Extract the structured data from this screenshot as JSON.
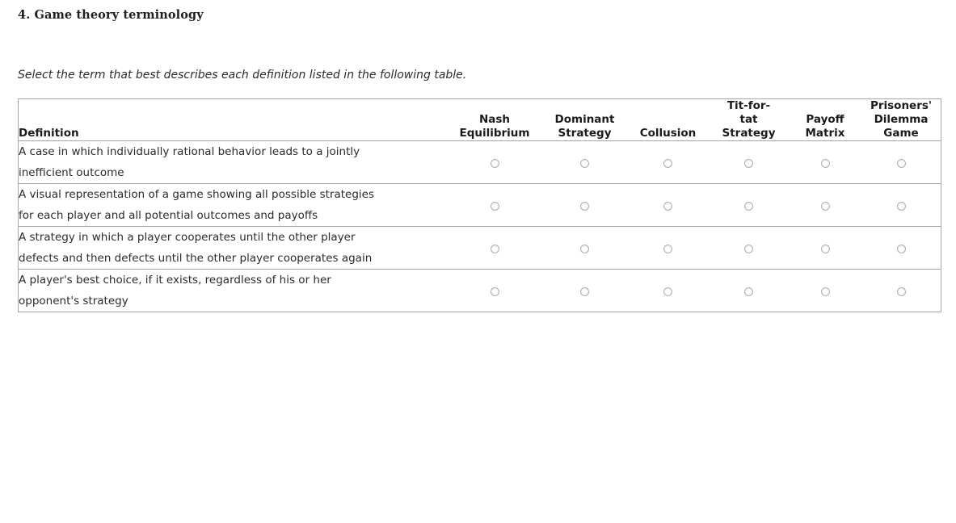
{
  "question": {
    "number_label": "4. Game theory terminology",
    "instruction": "Select the term that best describes each definition listed in the following table."
  },
  "table": {
    "definition_header": "Definition",
    "option_headers": [
      {
        "name": "nash-equilibrium",
        "lines": [
          "Nash",
          "Equilibrium"
        ]
      },
      {
        "name": "dominant-strategy",
        "lines": [
          "Dominant",
          "Strategy"
        ]
      },
      {
        "name": "collusion",
        "lines": [
          "Collusion"
        ]
      },
      {
        "name": "tit-for-tat-strategy",
        "lines": [
          "Tit-for-",
          "tat",
          "Strategy"
        ]
      },
      {
        "name": "payoff-matrix",
        "lines": [
          "Payoff",
          "Matrix"
        ]
      },
      {
        "name": "prisoners-dilemma-game",
        "lines": [
          "Prisoners'",
          "Dilemma",
          "Game"
        ]
      }
    ],
    "rows": [
      {
        "name": "row-prisoners-dilemma",
        "definition_lines": [
          "A case in which individually rational behavior leads to a jointly",
          "inefficient outcome"
        ],
        "selected": null
      },
      {
        "name": "row-payoff-matrix",
        "definition_lines": [
          "A visual representation of a game showing all possible strategies",
          "for each player and all potential outcomes and payoffs"
        ],
        "selected": null
      },
      {
        "name": "row-tit-for-tat",
        "definition_lines": [
          "A strategy in which a player cooperates until the other player",
          "defects and then defects until the other player cooperates again"
        ],
        "selected": null
      },
      {
        "name": "row-dominant-strategy",
        "definition_lines": [
          "A player's best choice, if it exists, regardless of his or her",
          "opponent's strategy"
        ],
        "selected": null
      }
    ]
  },
  "colors": {
    "border": "#a6a6a6",
    "text": "#2b2b2b",
    "heading": "#1f1f1f",
    "radio_border": "#b0b0b0"
  }
}
